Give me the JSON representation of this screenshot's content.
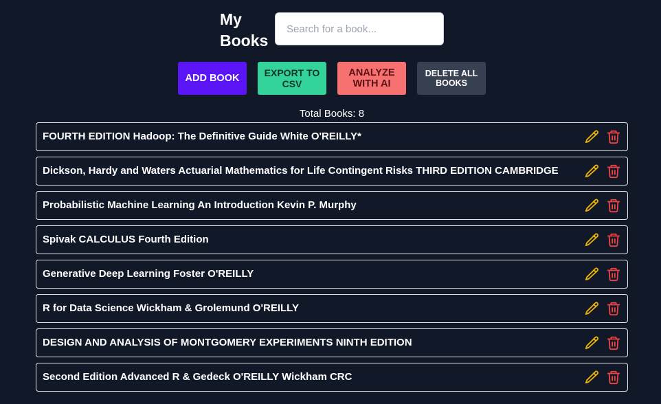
{
  "header": {
    "title": "My Books",
    "search_placeholder": "Search for a book..."
  },
  "toolbar": {
    "add_label": "ADD BOOK",
    "export_label": "EXPORT TO CSV",
    "analyze_label": "ANALYZE WITH AI",
    "delete_all_label": "DELETE ALL BOOKS"
  },
  "summary": {
    "total_text": "Total Books: 8"
  },
  "books": [
    {
      "title": "FOURTH EDITION Hadoop: The Definitive Guide White O'REILLY*"
    },
    {
      "title": "Dickson, Hardy and Waters Actuarial Mathematics for Life Contingent Risks THIRD EDITION CAMBRIDGE"
    },
    {
      "title": "Probabilistic Machine Learning An Introduction Kevin P. Murphy"
    },
    {
      "title": "Spivak CALCULUS Fourth Edition"
    },
    {
      "title": "Generative Deep Learning Foster O'REILLY"
    },
    {
      "title": "R for Data Science Wickham & Grolemund O'REILLY"
    },
    {
      "title": "DESIGN AND ANALYSIS OF MONTGOMERY EXPERIMENTS NINTH EDITION"
    },
    {
      "title": "Second Edition Advanced R & Gedeck O'REILLY Wickham CRC"
    }
  ],
  "icons": {
    "edit": "pencil-icon",
    "delete": "trash-icon"
  },
  "colors": {
    "background": "#111827",
    "add_button": "#5b14f5",
    "export_button": "#34d399",
    "analyze_button": "#f87171",
    "delete_all_button": "#374151",
    "edit_icon": "#eab308",
    "delete_icon": "#ef4444"
  }
}
